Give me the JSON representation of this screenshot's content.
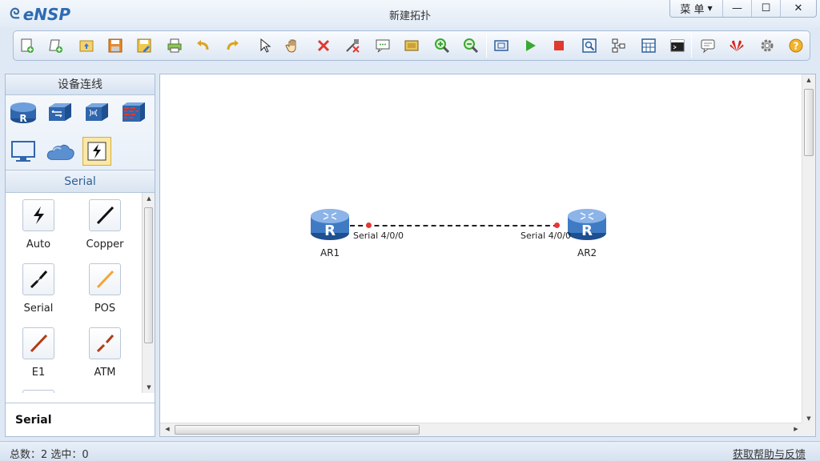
{
  "window": {
    "app_name": "eNSP",
    "title": "新建拓扑",
    "menu_label": "菜 单",
    "minimize_glyph": "—",
    "maximize_glyph": "☐",
    "close_glyph": "✕"
  },
  "toolbar": {
    "icons": [
      "new-topology-icon",
      "new-lab-icon",
      "open-icon",
      "save-icon",
      "save-as-icon",
      "print-icon",
      "undo-icon",
      "redo-icon",
      "select-pointer-icon",
      "pan-hand-icon",
      "delete-icon",
      "delete-link-icon",
      "text-annotation-icon",
      "palette-icon",
      "zoom-in-icon",
      "zoom-out-icon",
      "fit-view-icon",
      "start-device-icon",
      "stop-device-icon",
      "capture-icon",
      "topology-icon",
      "grid-icon",
      "console-icon",
      "chat-icon",
      "huawei-logo-icon",
      "settings-icon",
      "help-icon"
    ]
  },
  "left_panel": {
    "header": "设备连线",
    "device_categories": [
      "router-category-icon",
      "switch-category-icon",
      "wlan-category-icon",
      "firewall-category-icon",
      "pc-category-icon",
      "cloud-category-icon",
      "connection-category-icon"
    ],
    "section_title": "Serial",
    "cables": [
      {
        "label": "Auto"
      },
      {
        "label": "Copper"
      },
      {
        "label": "Serial"
      },
      {
        "label": "POS"
      },
      {
        "label": "E1"
      },
      {
        "label": "ATM"
      }
    ],
    "selected_name": "Serial"
  },
  "canvas": {
    "devices": [
      {
        "name": "AR1",
        "port": "Serial 4/0/0"
      },
      {
        "name": "AR2",
        "port": "Serial 4/0/0"
      }
    ],
    "link_style": "dashed"
  },
  "status": {
    "summary": "总数：2  选中：0",
    "help_link": "获取帮助与反馈"
  },
  "colors": {
    "accent": "#2d6bb3",
    "router_body": "#3f7bc4",
    "port_dot": "#e53935",
    "selected_bg": "#fbe8a6"
  }
}
